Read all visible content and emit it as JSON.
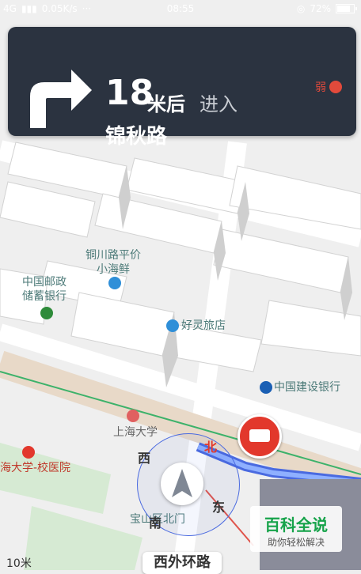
{
  "status_bar": {
    "network": "4G",
    "speed": "0.05K/s",
    "dots": "···",
    "time": "08:55",
    "battery": "72%"
  },
  "navigation": {
    "distance": "18",
    "distance_unit": "米后",
    "action": "进入",
    "road_name": "锦秋路",
    "signal_label": "弱"
  },
  "map": {
    "pois": [
      {
        "name": "铜川路平价\n小海鲜"
      },
      {
        "name": "中国邮政\n储蓄银行"
      },
      {
        "name": "好灵旅店"
      },
      {
        "name": "中国建设银行"
      },
      {
        "name": "上海大学"
      },
      {
        "name": "海大学-校医院"
      },
      {
        "name": "宝山区北门"
      }
    ],
    "compass": {
      "north": "北",
      "west": "西",
      "east": "东",
      "south": "南"
    },
    "current_road": "西外环路",
    "scale": "10米",
    "watermark_title": "百科全说",
    "watermark_sub": "助你轻松解决"
  },
  "colors": {
    "banner_bg": "#2b3340",
    "route_blue": "#4a6ae0",
    "camera_red": "#e2382c",
    "accent_green": "#16a34a"
  }
}
